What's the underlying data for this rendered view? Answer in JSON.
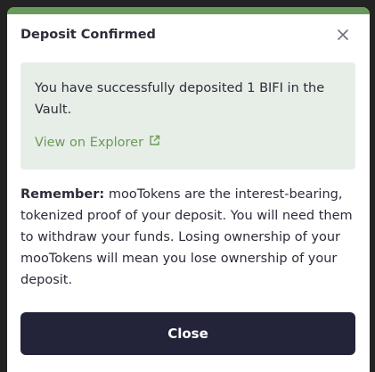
{
  "modal": {
    "title": "Deposit Confirmed",
    "close_icon": "close-icon",
    "success_message": "You have successfully deposited 1 BIFI in the Vault.",
    "explorer_link": "View on Explorer",
    "explorer_icon": "external-link-icon",
    "remember_label": "Remember:",
    "remember_text": " mooTokens are the interest-bearing, tokenized proof of your deposit. You will need them to withdraw your funds. Losing ownership of your mooTokens will mean you lose ownership of your deposit.",
    "close_button_label": "Close"
  },
  "colors": {
    "accent_green": "#6a9a5b",
    "success_bg": "#e7eee7",
    "button_dark": "#23243a",
    "text_dark": "#2c2c3a"
  }
}
